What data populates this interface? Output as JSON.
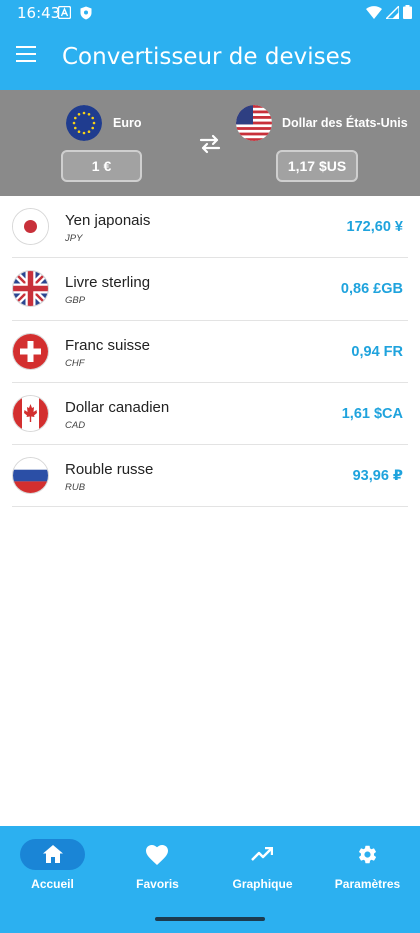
{
  "status_bar": {
    "time": "16:43"
  },
  "app_bar": {
    "title": "Convertisseur de devises"
  },
  "converter": {
    "from": {
      "name": "Euro",
      "amount": "1 €",
      "flag": "eu-flag-icon"
    },
    "to": {
      "name": "Dollar des États-Unis",
      "amount": "1,17 $US",
      "flag": "us-flag-icon"
    }
  },
  "currencies": [
    {
      "name": "Yen japonais",
      "code": "JPY",
      "value": "172,60 ¥",
      "flag": "japan-flag-icon"
    },
    {
      "name": "Livre sterling",
      "code": "GBP",
      "value": "0,86 £GB",
      "flag": "uk-flag-icon"
    },
    {
      "name": "Franc suisse",
      "code": "CHF",
      "value": "0,94 FR",
      "flag": "swiss-flag-icon"
    },
    {
      "name": "Dollar canadien",
      "code": "CAD",
      "value": "1,61 $CA",
      "flag": "canada-flag-icon"
    },
    {
      "name": "Rouble russe",
      "code": "RUB",
      "value": "93,96 ₽",
      "flag": "russia-flag-icon"
    }
  ],
  "bottom_nav": [
    {
      "label": "Accueil",
      "icon": "home-icon",
      "active": true
    },
    {
      "label": "Favoris",
      "icon": "heart-icon",
      "active": false
    },
    {
      "label": "Graphique",
      "icon": "trending-up-icon",
      "active": false
    },
    {
      "label": "Paramètres",
      "icon": "gear-icon",
      "active": false
    }
  ],
  "colors": {
    "primary": "#2cb0f0",
    "header_gray": "#8a8a8a",
    "value_blue": "#1fa3dd",
    "nav_pill": "#1a85d6"
  }
}
